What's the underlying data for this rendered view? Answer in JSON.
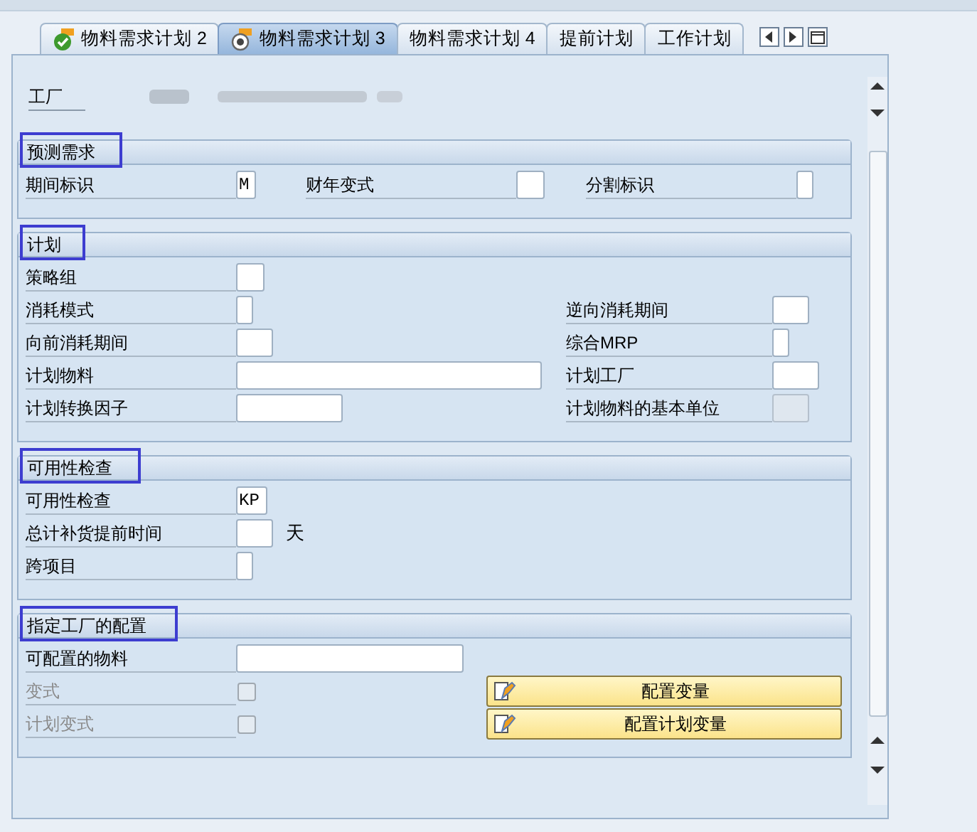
{
  "tabs": [
    {
      "label": "物料需求计划 2",
      "selected": false,
      "kind": "check"
    },
    {
      "label": "物料需求计划 3",
      "selected": true,
      "kind": "radio"
    },
    {
      "label": "物料需求计划 4",
      "selected": false
    },
    {
      "label": "提前计划",
      "selected": false
    },
    {
      "label": "工作计划",
      "selected": false
    }
  ],
  "plant": {
    "label": "工厂"
  },
  "sections": [
    {
      "title": "预测需求",
      "highlighted": true,
      "rows": [
        [
          {
            "kind": "input",
            "label": "期间标识",
            "value": "M",
            "disabled": false
          },
          {
            "kind": "input",
            "label": "财年变式",
            "disabled": false
          },
          {
            "kind": "input",
            "label": "分割标识",
            "disabled": false
          }
        ]
      ]
    },
    {
      "title": "计划",
      "highlighted": true,
      "rows": [
        [
          {
            "kind": "input",
            "label": "策略组",
            "disabled": false
          }
        ],
        [
          {
            "kind": "input",
            "label": "消耗模式",
            "disabled": false
          },
          {
            "kind": "input",
            "label": "逆向消耗期间",
            "disabled": false
          }
        ],
        [
          {
            "kind": "input",
            "label": "向前消耗期间",
            "disabled": false
          },
          {
            "kind": "input",
            "label": "综合MRP",
            "disabled": false
          }
        ],
        [
          {
            "kind": "input",
            "label": "计划物料",
            "disabled": false
          },
          {
            "kind": "input",
            "label": "计划工厂",
            "disabled": false
          }
        ],
        [
          {
            "kind": "input",
            "label": "计划转换因子",
            "disabled": false
          },
          {
            "kind": "input",
            "label": "计划物料的基本单位",
            "disabled": true
          }
        ]
      ]
    },
    {
      "title": "可用性检查",
      "highlighted": true,
      "rows": [
        [
          {
            "kind": "input",
            "label": "可用性检查",
            "value": "KP",
            "disabled": false
          }
        ],
        [
          {
            "kind": "input",
            "label": "总计补货提前时间",
            "unit": "天",
            "disabled": false
          }
        ],
        [
          {
            "kind": "input",
            "label": "跨项目",
            "disabled": false
          }
        ]
      ]
    },
    {
      "title": "指定工厂的配置",
      "highlighted": true,
      "rows": [
        [
          {
            "kind": "input",
            "label": "可配置的物料",
            "disabled": false
          }
        ],
        [
          {
            "kind": "checkbox",
            "label": "变式",
            "checked": false,
            "disabled": true
          },
          {
            "kind": "button",
            "label": "配置变量"
          }
        ],
        [
          {
            "kind": "checkbox",
            "label": "计划变式",
            "checked": false,
            "disabled": true
          },
          {
            "kind": "button",
            "label": "配置计划变量"
          }
        ]
      ]
    }
  ]
}
